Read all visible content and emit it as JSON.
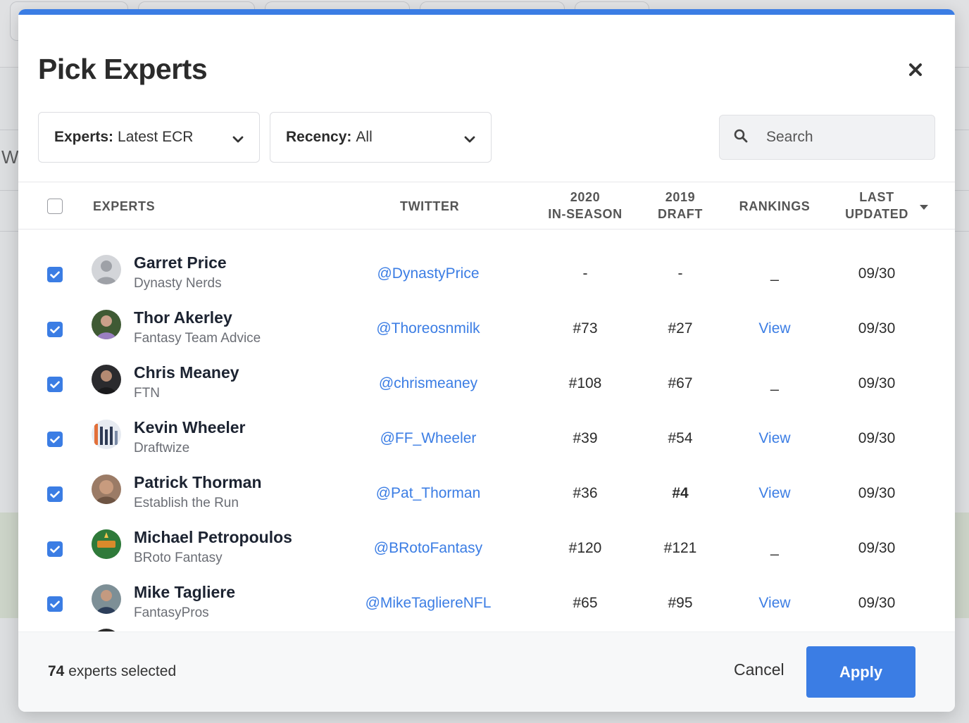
{
  "modal": {
    "title": "Pick Experts",
    "accent_color": "#3b7de4"
  },
  "filters": {
    "experts": {
      "label": "Experts:",
      "value": "Latest ECR"
    },
    "recency": {
      "label": "Recency:",
      "value": "All"
    },
    "search_placeholder": "Search"
  },
  "table": {
    "headers": {
      "experts": "EXPERTS",
      "twitter": "TWITTER",
      "in_season_1": "2020",
      "in_season_2": "IN-SEASON",
      "draft_1": "2019",
      "draft_2": "DRAFT",
      "rankings": "RANKINGS",
      "updated_1": "LAST",
      "updated_2": "UPDATED"
    },
    "rows": [
      {
        "name": "Garret Price",
        "org": "Dynasty Nerds",
        "twitter": "@DynastyPrice",
        "in_season": "-",
        "draft": "-",
        "rankings": "_",
        "updated": "09/30",
        "checked": true
      },
      {
        "name": "Thor Akerley",
        "org": "Fantasy Team Advice",
        "twitter": "@Thoreosnmilk",
        "in_season": "#73",
        "draft": "#27",
        "rankings": "View",
        "updated": "09/30",
        "checked": true
      },
      {
        "name": "Chris Meaney",
        "org": "FTN",
        "twitter": "@chrismeaney",
        "in_season": "#108",
        "draft": "#67",
        "rankings": "_",
        "updated": "09/30",
        "checked": true
      },
      {
        "name": "Kevin Wheeler",
        "org": "Draftwize",
        "twitter": "@FF_Wheeler",
        "in_season": "#39",
        "draft": "#54",
        "rankings": "View",
        "updated": "09/30",
        "checked": true
      },
      {
        "name": "Patrick Thorman",
        "org": "Establish the Run",
        "twitter": "@Pat_Thorman",
        "in_season": "#36",
        "draft": "#4",
        "rankings": "View",
        "updated": "09/30",
        "checked": true
      },
      {
        "name": "Michael Petropoulos",
        "org": "BRoto Fantasy",
        "twitter": "@BRotoFantasy",
        "in_season": "#120",
        "draft": "#121",
        "rankings": "_",
        "updated": "09/30",
        "checked": true
      },
      {
        "name": "Mike Tagliere",
        "org": "FantasyPros",
        "twitter": "@MikeTagliereNFL",
        "in_season": "#65",
        "draft": "#95",
        "rankings": "View",
        "updated": "09/30",
        "checked": true
      }
    ]
  },
  "footer": {
    "count": "74",
    "count_suffix": "experts selected",
    "cancel_label": "Cancel",
    "apply_label": "Apply"
  },
  "background": {
    "partial_letter": "W"
  }
}
